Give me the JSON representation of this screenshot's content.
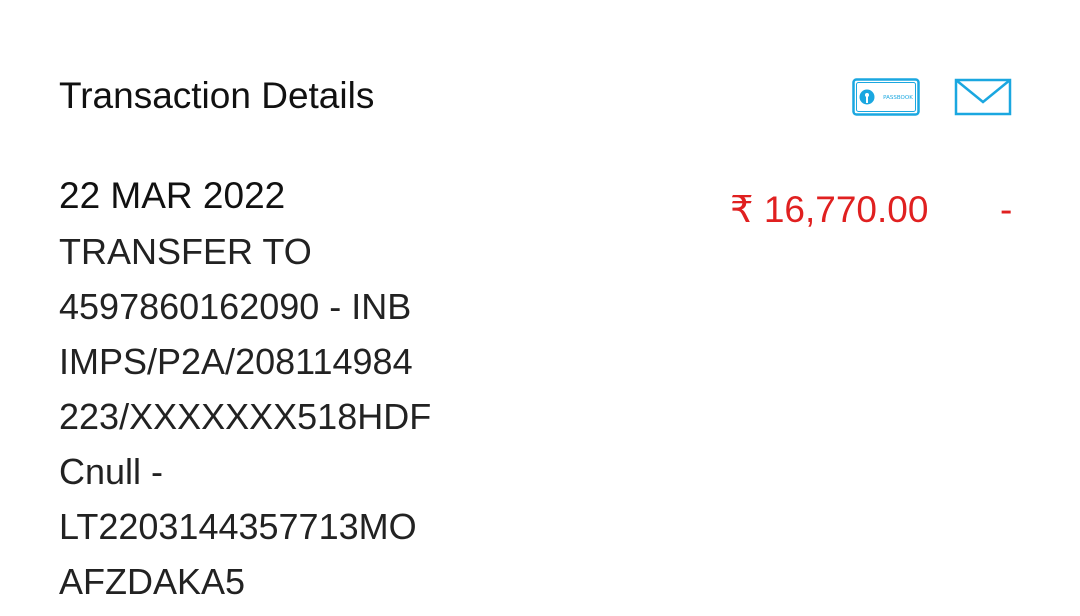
{
  "header": {
    "title": "Transaction Details",
    "actions": [
      {
        "name": "passbook",
        "icon": "passbook-icon",
        "icon_text": "PASSBOOK"
      },
      {
        "name": "email",
        "icon": "mail-icon"
      }
    ]
  },
  "transaction": {
    "date": "22 MAR 2022",
    "description_lines": [
      "TRANSFER TO",
      "4597860162090 - INB",
      "IMPS/P2A/208114984",
      "223/XXXXXXX518HDF",
      "Cnull -",
      "LT2203144357713MO",
      "AFZDAKA5"
    ],
    "amount": "₹ 16,770.00",
    "sign": "-"
  },
  "colors": {
    "accent": "#1aa7e0",
    "debit": "#e02020",
    "text": "#111111"
  }
}
